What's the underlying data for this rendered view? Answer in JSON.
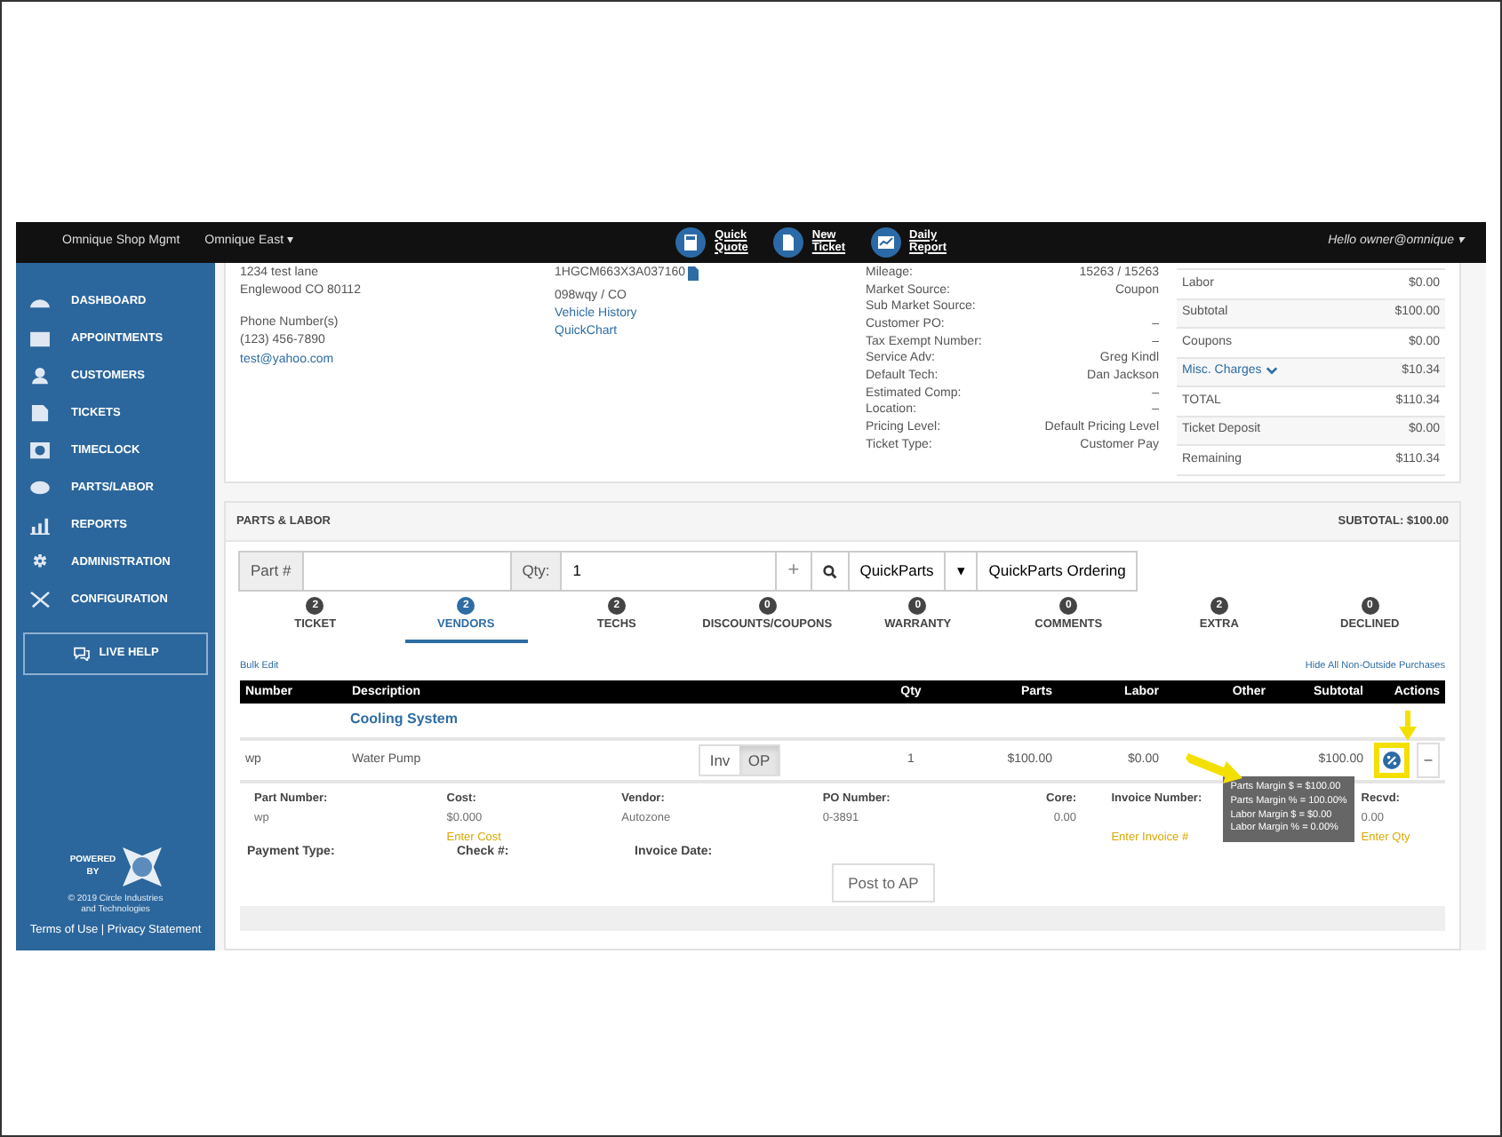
{
  "navbar": {
    "brand": "Omnique Shop Mgmt",
    "location": "Omnique East ▾",
    "actions": [
      {
        "kind": "calculator",
        "line1": "Quick",
        "line2": "Quote"
      },
      {
        "kind": "document",
        "line1": "New",
        "line2": "Ticket"
      },
      {
        "kind": "report",
        "line1": "Daily",
        "line2": "Report"
      }
    ],
    "user": "Hello owner@omnique ▾"
  },
  "sidebar": {
    "items": [
      {
        "kind": "gauge",
        "label": "DASHBOARD"
      },
      {
        "kind": "calendar",
        "label": "APPOINTMENTS"
      },
      {
        "kind": "person",
        "label": "CUSTOMERS"
      },
      {
        "kind": "document",
        "label": "TICKETS"
      },
      {
        "kind": "clock",
        "label": "TIMECLOCK"
      },
      {
        "kind": "disc",
        "label": "PARTS/LABOR"
      },
      {
        "kind": "chart",
        "label": "REPORTS"
      },
      {
        "kind": "gear",
        "label": "ADMINISTRATION"
      },
      {
        "kind": "tools",
        "label": "CONFIGURATION"
      }
    ],
    "live_help": "LIVE HELP",
    "powered_by": "POWERED BY",
    "copyright": [
      "© 2019 Circle Industries",
      "and Technologies"
    ],
    "footer_links": "Terms of Use | Privacy Statement"
  },
  "ticket": {
    "customer": {
      "address": [
        "1234 test lane",
        "Englewood CO 80112"
      ],
      "phone_label": "Phone Number(s)",
      "phone": "(123) 456-7890",
      "email": "test@yahoo.com"
    },
    "vehicle": {
      "vin": "1HGCM663X3A037160",
      "plate": "098wqy / CO",
      "links": [
        "Vehicle History",
        "QuickChart"
      ]
    },
    "details": [
      {
        "label": "Mileage:",
        "value": "15263 / 15263"
      },
      {
        "label": "Market Source:",
        "value": "Coupon"
      },
      {
        "label": "Sub Market Source:"
      },
      {
        "label": "Customer PO:",
        "value": "–"
      },
      {
        "label": "Tax Exempt Number:",
        "value": "–"
      },
      {
        "label": "Service Adv:",
        "value": "Greg Kindl"
      },
      {
        "label": "Default Tech:",
        "value": "Dan Jackson"
      },
      {
        "label": "Estimated Comp:",
        "value": "–"
      },
      {
        "label": "Location:",
        "value": "–"
      },
      {
        "label": "Pricing Level:",
        "value": "Default Pricing Level"
      },
      {
        "label": "Ticket Type:",
        "value": "Customer Pay"
      }
    ],
    "totals": [
      {
        "kind": "plain",
        "label": "Labor",
        "value": "$0.00"
      },
      {
        "kind": "plain",
        "label": "Subtotal",
        "value": "$100.00"
      },
      {
        "kind": "plain",
        "label": "Coupons",
        "value": "$0.00"
      },
      {
        "kind": "link",
        "label": "Misc. Charges",
        "value": "$10.34"
      },
      {
        "kind": "plain",
        "label": "TOTAL",
        "value": "$110.34"
      },
      {
        "kind": "plain",
        "label": "Ticket Deposit",
        "value": "$0.00"
      },
      {
        "kind": "plain",
        "label": "Remaining",
        "value": "$110.34"
      }
    ]
  },
  "parts_labor": {
    "title": "PARTS & LABOR",
    "subtotal": "SUBTOTAL: $100.00",
    "search": {
      "part_label": "Part #",
      "qty_label": "Qty:",
      "qty_value": "1",
      "add": "+",
      "quickparts": "QuickParts",
      "caret": "▾",
      "ordering": "QuickParts Ordering"
    },
    "tabs": [
      {
        "count": "2",
        "label": "TICKET",
        "selected": false
      },
      {
        "count": "2",
        "label": "VENDORS",
        "selected": true
      },
      {
        "count": "2",
        "label": "TECHS",
        "selected": false
      },
      {
        "count": "0",
        "label": "DISCOUNTS/COUPONS",
        "selected": false
      },
      {
        "count": "0",
        "label": "WARRANTY",
        "selected": false
      },
      {
        "count": "0",
        "label": "COMMENTS",
        "selected": false
      },
      {
        "count": "2",
        "label": "EXTRA",
        "selected": false
      },
      {
        "count": "0",
        "label": "DECLINED",
        "selected": false
      }
    ],
    "bulk_edit": "Bulk Edit",
    "hide_link": "Hide All Non-Outside Purchases",
    "columns": [
      "Number",
      "Description",
      "Qty",
      "Parts",
      "Labor",
      "Other",
      "Subtotal",
      "Actions"
    ],
    "group": "Cooling System",
    "row": {
      "number": "wp",
      "description": "Water Pump",
      "toggle": [
        {
          "label": "Inv",
          "selected": false
        },
        {
          "label": "OP",
          "selected": true
        }
      ],
      "qty": "1",
      "parts": "$100.00",
      "labor": "$0.00",
      "subtotal": "$100.00",
      "remove": "–"
    },
    "detail_fields": [
      {
        "label": "Part Number:",
        "value": "wp"
      },
      {
        "label": "Cost:",
        "value": "$0.000",
        "action": "Enter Cost"
      },
      {
        "label": "Vendor:",
        "value": "Autozone"
      },
      {
        "label": "PO Number:",
        "value": "0-3891"
      },
      {
        "label": "Core:",
        "value": "0.00"
      },
      {
        "label": "Invoice Number:",
        "action": "Enter Invoice #"
      },
      {
        "label": "Recvd:",
        "value": "0.00",
        "action": "Enter Qty"
      }
    ],
    "payment_fields": [
      "Payment Type:",
      "Check #:",
      "Invoice Date:"
    ],
    "post_button": "Post to AP",
    "tooltip": [
      "Parts Margin $ = $100.00",
      "Parts Margin % = 100.00%",
      "Labor Margin $ = $0.00",
      "Labor Margin % = 0.00%"
    ]
  }
}
